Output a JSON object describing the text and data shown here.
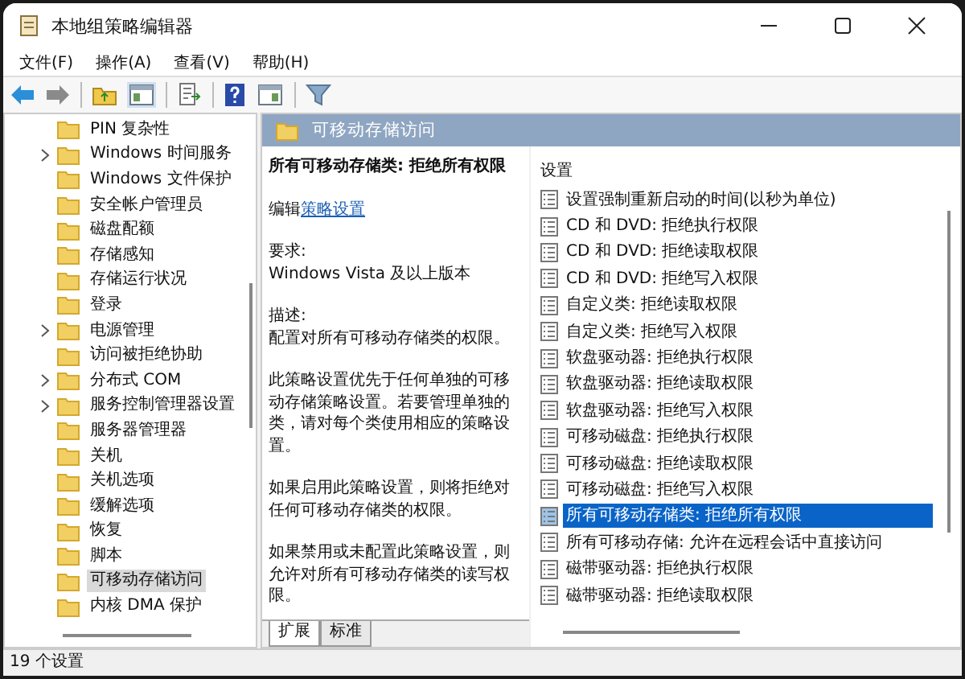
{
  "window": {
    "title": "本地组策略编辑器"
  },
  "menu": [
    "文件(F)",
    "操作(A)",
    "查看(V)",
    "帮助(H)"
  ],
  "tree": [
    {
      "label": "PIN 复杂性",
      "expandable": false,
      "selected": false
    },
    {
      "label": "Windows 时间服务",
      "expandable": true,
      "selected": false
    },
    {
      "label": "Windows 文件保护",
      "expandable": false,
      "selected": false
    },
    {
      "label": "安全帐户管理员",
      "expandable": false,
      "selected": false
    },
    {
      "label": "磁盘配额",
      "expandable": false,
      "selected": false
    },
    {
      "label": "存储感知",
      "expandable": false,
      "selected": false
    },
    {
      "label": "存储运行状况",
      "expandable": false,
      "selected": false
    },
    {
      "label": "登录",
      "expandable": false,
      "selected": false
    },
    {
      "label": "电源管理",
      "expandable": true,
      "selected": false
    },
    {
      "label": "访问被拒绝协助",
      "expandable": false,
      "selected": false
    },
    {
      "label": "分布式 COM",
      "expandable": true,
      "selected": false
    },
    {
      "label": "服务控制管理器设置",
      "expandable": true,
      "selected": false
    },
    {
      "label": "服务器管理器",
      "expandable": false,
      "selected": false
    },
    {
      "label": "关机",
      "expandable": false,
      "selected": false
    },
    {
      "label": "关机选项",
      "expandable": false,
      "selected": false
    },
    {
      "label": "缓解选项",
      "expandable": false,
      "selected": false
    },
    {
      "label": "恢复",
      "expandable": false,
      "selected": false
    },
    {
      "label": "脚本",
      "expandable": false,
      "selected": false
    },
    {
      "label": "可移动存储访问",
      "expandable": false,
      "selected": true
    },
    {
      "label": "内核 DMA 保护",
      "expandable": false,
      "selected": false
    }
  ],
  "panel": {
    "title": "可移动存储访问",
    "policy_title": "所有可移动存储类: 拒绝所有权限",
    "edit_prefix": "编辑",
    "edit_link": "策略设置",
    "requirements_label": "要求:",
    "requirements": "Windows Vista 及以上版本",
    "description_label": "描述:",
    "paragraphs": [
      "配置对所有可移动存储类的权限。",
      "此策略设置优先于任何单独的可移动存储策略设置。若要管理单独的类，请对每个类使用相应的策略设置。",
      "如果启用此策略设置，则将拒绝对任何可移动存储类的权限。",
      "如果禁用或未配置此策略设置，则允许对所有可移动存储类的读写权限。"
    ],
    "tabs": [
      {
        "label": "扩展",
        "selected": true
      },
      {
        "label": "标准",
        "selected": false
      }
    ]
  },
  "settings": {
    "column": "设置",
    "items": [
      {
        "label": "设置强制重新启动的时间(以秒为单位)",
        "selected": false
      },
      {
        "label": "CD 和 DVD: 拒绝执行权限",
        "selected": false
      },
      {
        "label": "CD 和 DVD: 拒绝读取权限",
        "selected": false
      },
      {
        "label": "CD 和 DVD: 拒绝写入权限",
        "selected": false
      },
      {
        "label": "自定义类: 拒绝读取权限",
        "selected": false
      },
      {
        "label": "自定义类: 拒绝写入权限",
        "selected": false
      },
      {
        "label": "软盘驱动器: 拒绝执行权限",
        "selected": false
      },
      {
        "label": "软盘驱动器: 拒绝读取权限",
        "selected": false
      },
      {
        "label": "软盘驱动器: 拒绝写入权限",
        "selected": false
      },
      {
        "label": "可移动磁盘: 拒绝执行权限",
        "selected": false
      },
      {
        "label": "可移动磁盘: 拒绝读取权限",
        "selected": false
      },
      {
        "label": "可移动磁盘: 拒绝写入权限",
        "selected": false
      },
      {
        "label": "所有可移动存储类: 拒绝所有权限",
        "selected": true
      },
      {
        "label": "所有可移动存储: 允许在远程会话中直接访问",
        "selected": false
      },
      {
        "label": "磁带驱动器: 拒绝执行权限",
        "selected": false
      },
      {
        "label": "磁带驱动器: 拒绝读取权限",
        "selected": false
      }
    ]
  },
  "status_bar": "19 个设置"
}
